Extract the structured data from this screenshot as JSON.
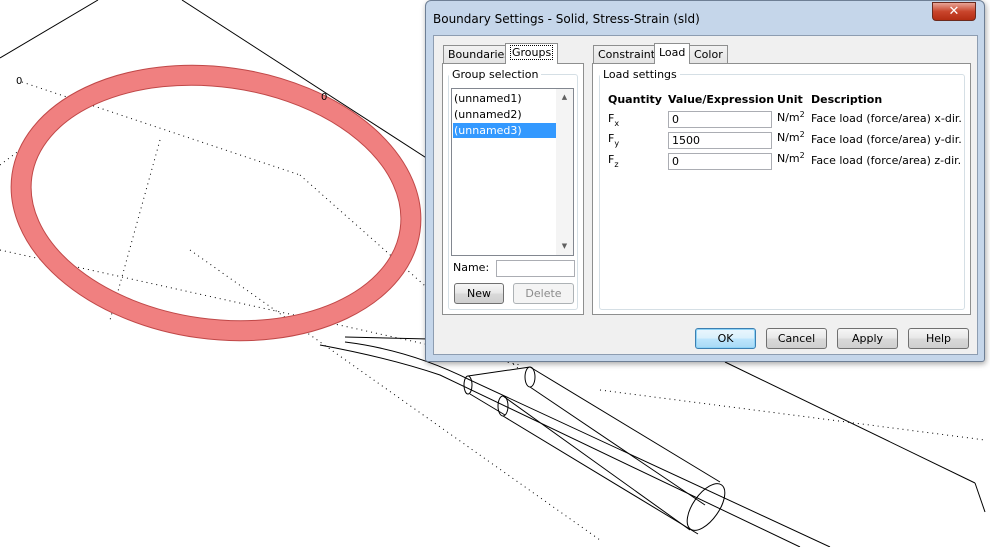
{
  "viewport": {
    "axis_labels": [
      "0",
      "0"
    ],
    "highlight_color": "#f08080"
  },
  "dialog": {
    "title": "Boundary Settings - Solid, Stress-Strain (sld)",
    "close_glyph": "✕",
    "left_tabs": [
      "Boundaries",
      "Groups"
    ],
    "left_active_tab": "Groups",
    "right_tabs": [
      "Constraint",
      "Load",
      "Color"
    ],
    "right_active_tab": "Load",
    "group_selection": {
      "label": "Group selection",
      "items": [
        "(unnamed1)",
        "(unnamed2)",
        "(unnamed3)"
      ],
      "selected": "(unnamed3)",
      "name_label": "Name:",
      "name_value": "",
      "new_label": "New",
      "delete_label": "Delete"
    },
    "load_settings": {
      "label": "Load settings",
      "headers": {
        "quantity": "Quantity",
        "value": "Value/Expression",
        "unit": "Unit",
        "description": "Description"
      },
      "rows": [
        {
          "q": "F",
          "sub": "x",
          "value": "0",
          "unit": "N/m",
          "exp": "2",
          "desc": "Face load (force/area) x-dir."
        },
        {
          "q": "F",
          "sub": "y",
          "value": "1500",
          "unit": "N/m",
          "exp": "2",
          "desc": "Face load (force/area) y-dir."
        },
        {
          "q": "F",
          "sub": "z",
          "value": "0",
          "unit": "N/m",
          "exp": "2",
          "desc": "Face load (force/area) z-dir."
        }
      ]
    },
    "buttons": {
      "ok": "OK",
      "cancel": "Cancel",
      "apply": "Apply",
      "help": "Help"
    }
  }
}
